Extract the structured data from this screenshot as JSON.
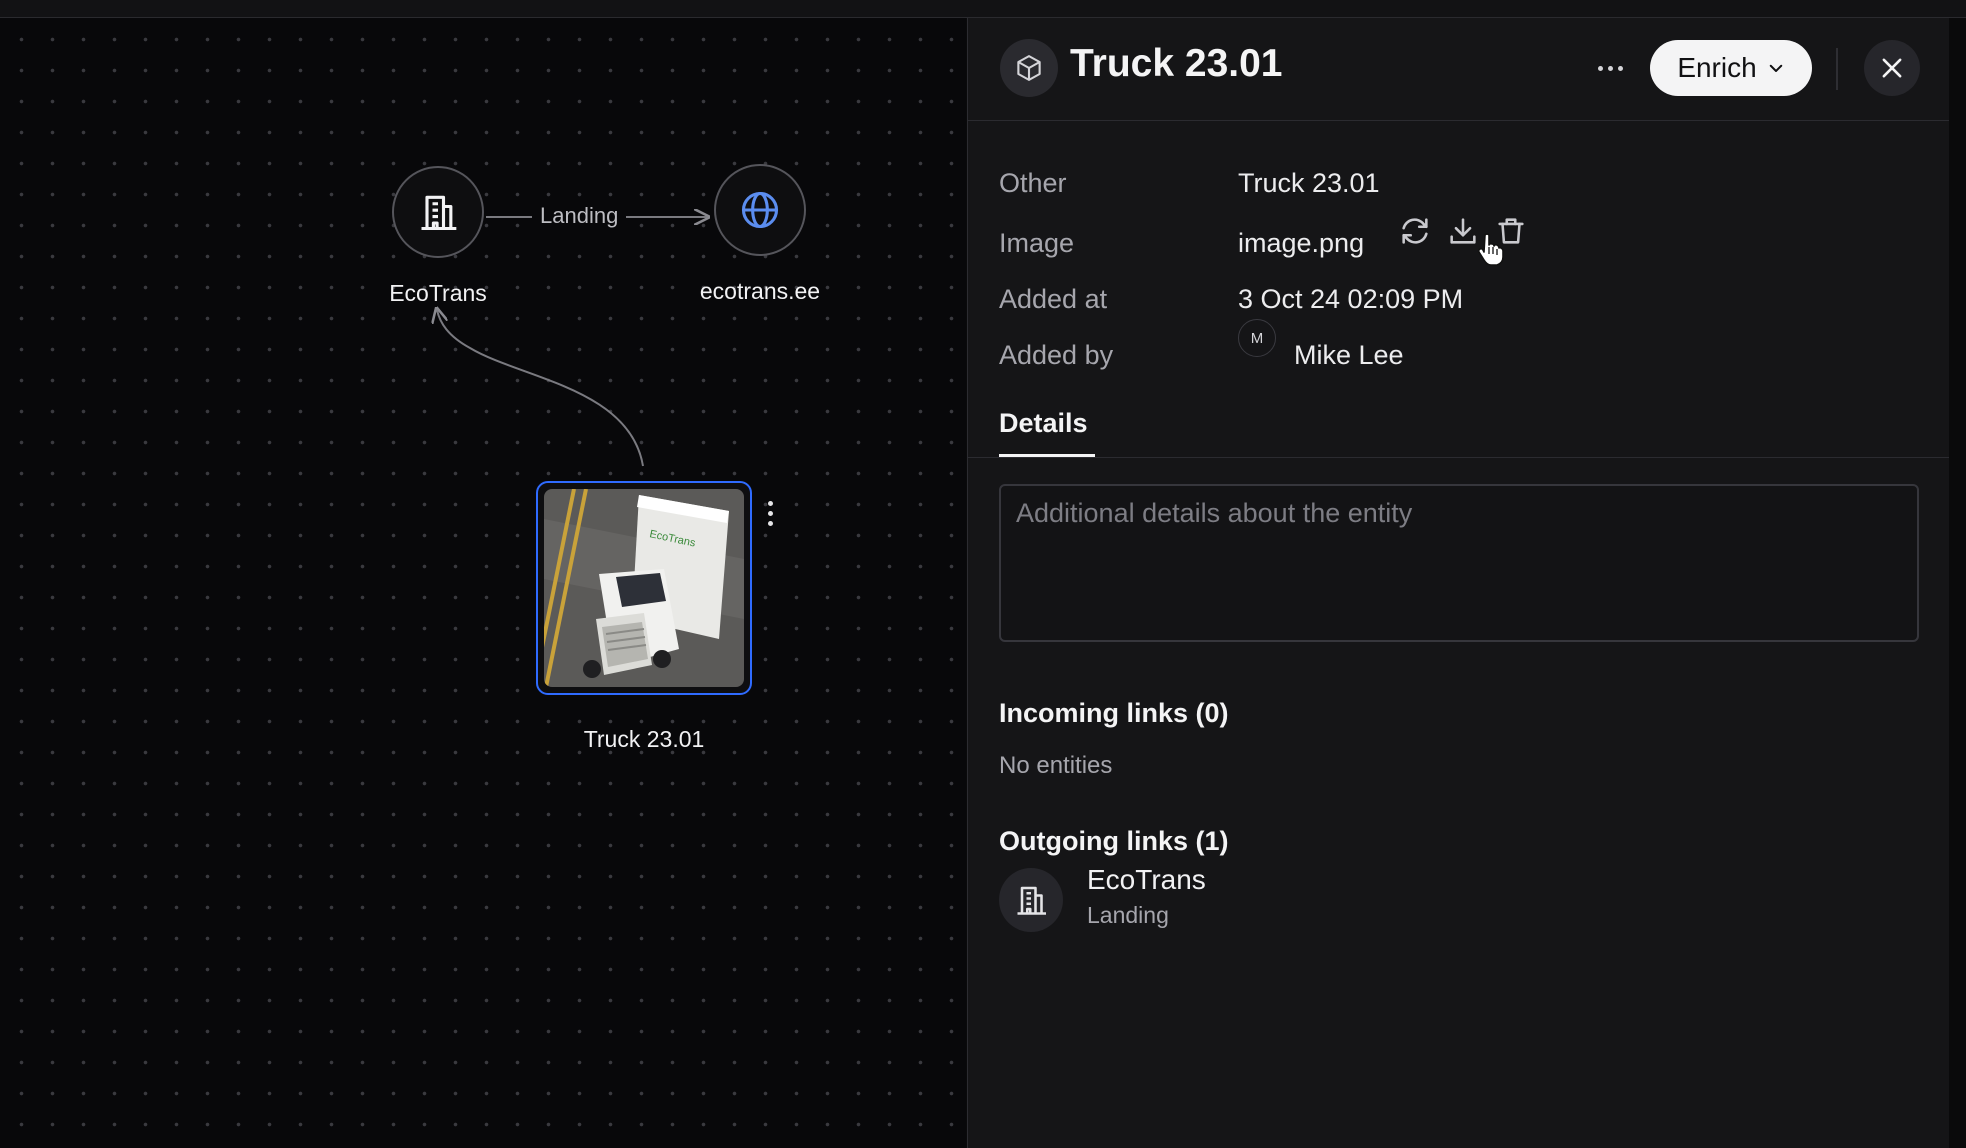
{
  "canvas": {
    "nodes": [
      {
        "id": "ecotrans",
        "label": "EcoTrans",
        "icon": "building-icon"
      },
      {
        "id": "ecotrans-ee",
        "label": "ecotrans.ee",
        "icon": "globe-icon"
      },
      {
        "id": "truck",
        "label": "Truck 23.01",
        "icon": "truck-image"
      }
    ],
    "edge_label": "Landing"
  },
  "panel": {
    "title": "Truck 23.01",
    "enrich_label": "Enrich",
    "properties": {
      "other_label": "Other",
      "other_value": "Truck 23.01",
      "image_label": "Image",
      "image_value": "image.png",
      "added_at_label": "Added at",
      "added_at_value": "3 Oct 24 02:09 PM",
      "added_by_label": "Added by",
      "added_by_initial": "M",
      "added_by_value": "Mike Lee"
    },
    "tab_details": "Details",
    "details_placeholder": "Additional details about the entity",
    "incoming_title": "Incoming links (0)",
    "incoming_empty": "No entities",
    "outgoing_title": "Outgoing links (1)",
    "outgoing": [
      {
        "name": "EcoTrans",
        "relation": "Landing",
        "icon": "building-icon"
      }
    ]
  },
  "colors": {
    "accent_blue": "#2f6bff",
    "globe_blue": "#5b8def",
    "panel_bg": "#151517"
  }
}
